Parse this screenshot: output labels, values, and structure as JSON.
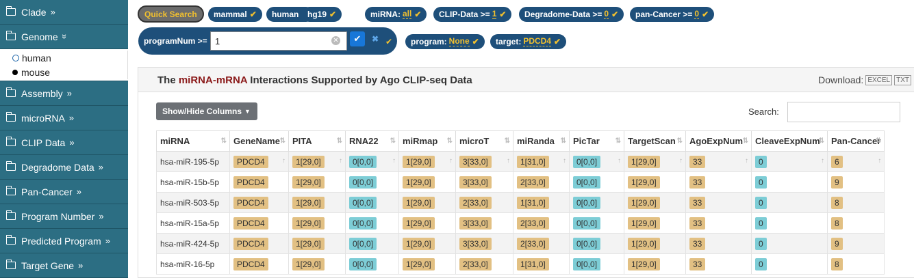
{
  "sidebar": {
    "items": [
      {
        "label": "Clade",
        "chev": "»"
      },
      {
        "label": "Genome",
        "chev": "»"
      },
      {
        "label": "Assembly",
        "chev": "»"
      },
      {
        "label": "microRNA",
        "chev": "»"
      },
      {
        "label": "CLIP Data",
        "chev": "»"
      },
      {
        "label": "Degradome Data",
        "chev": "»"
      },
      {
        "label": "Pan-Cancer",
        "chev": "»"
      },
      {
        "label": "Program Number",
        "chev": "»"
      },
      {
        "label": "Predicted Program",
        "chev": "»"
      },
      {
        "label": "Target Gene",
        "chev": "»"
      }
    ],
    "genome_options": [
      "human",
      "mouse"
    ]
  },
  "filters": {
    "quick_search": "Quick Search",
    "mammal": "mammal",
    "human": "human",
    "hg19": "hg19",
    "mirna_label": "miRNA:",
    "mirna_val": "all",
    "clip_label": "CLIP-Data >=",
    "clip_val": "1",
    "degradome_label": "Degradome-Data >=",
    "degradome_val": "0",
    "pancancer_label": "pan-Cancer >=",
    "pancancer_val": "0",
    "prognum_label": "programNum >=",
    "prognum_value": "1",
    "program_label": "program:",
    "program_val": "None",
    "target_label": "target:",
    "target_val": "PDCD4"
  },
  "panel": {
    "title_pre": "The",
    "title_em": "miRNA-mRNA",
    "title_post": "Interactions Supported by Ago CLIP-seq Data",
    "download": "Download:",
    "excel": "EXCEL",
    "txt": "TXT",
    "showhide": "Show/Hide Columns",
    "search": "Search:"
  },
  "table": {
    "columns": [
      "miRNA",
      "GeneName",
      "PITA",
      "RNA22",
      "miRmap",
      "microT",
      "miRanda",
      "PicTar",
      "TargetScan",
      "AgoExpNum",
      "CleaveExpNum",
      "Pan-Cancer"
    ],
    "rows": [
      [
        "hsa-miR-195-5p",
        "PDCD4",
        "1[29,0]",
        "0[0,0]",
        "1[29,0]",
        "3[33,0]",
        "1[31,0]",
        "0[0,0]",
        "1[29,0]",
        "33",
        "0",
        "6"
      ],
      [
        "hsa-miR-15b-5p",
        "PDCD4",
        "1[29,0]",
        "0[0,0]",
        "1[29,0]",
        "3[33,0]",
        "2[33,0]",
        "0[0,0]",
        "1[29,0]",
        "33",
        "0",
        "9"
      ],
      [
        "hsa-miR-503-5p",
        "PDCD4",
        "1[29,0]",
        "0[0,0]",
        "1[29,0]",
        "2[33,0]",
        "1[31,0]",
        "0[0,0]",
        "1[29,0]",
        "33",
        "0",
        "8"
      ],
      [
        "hsa-miR-15a-5p",
        "PDCD4",
        "1[29,0]",
        "0[0,0]",
        "1[29,0]",
        "3[33,0]",
        "2[33,0]",
        "0[0,0]",
        "1[29,0]",
        "33",
        "0",
        "8"
      ],
      [
        "hsa-miR-424-5p",
        "PDCD4",
        "1[29,0]",
        "0[0,0]",
        "1[29,0]",
        "3[33,0]",
        "2[33,0]",
        "0[0,0]",
        "1[29,0]",
        "33",
        "0",
        "9"
      ],
      [
        "hsa-miR-16-5p",
        "PDCD4",
        "1[29,0]",
        "0[0,0]",
        "1[29,0]",
        "2[33,0]",
        "1[31,0]",
        "0[0,0]",
        "1[29,0]",
        "33",
        "0",
        "8"
      ]
    ]
  },
  "colors": {
    "sidebar": "#2c6e83",
    "chip": "#1e4f7a",
    "accent": "#f3c12e",
    "tan_badge": "#e2c083",
    "cyan_badge": "#7dcdd6"
  }
}
